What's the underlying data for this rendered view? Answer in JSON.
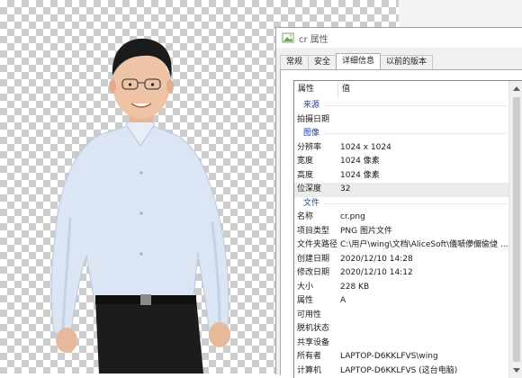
{
  "window": {
    "title": "cr 属性",
    "tabs": [
      {
        "label": "常规"
      },
      {
        "label": "安全"
      },
      {
        "label": "详细信息"
      },
      {
        "label": "以前的版本"
      }
    ]
  },
  "columns": {
    "property": "属性",
    "value": "值"
  },
  "rows": [
    {
      "group": "来源"
    },
    {
      "key": "拍摄日期",
      "value": ""
    },
    {
      "group": "图像"
    },
    {
      "key": "分辨率",
      "value": "1024 x 1024"
    },
    {
      "key": "宽度",
      "value": "1024 像素"
    },
    {
      "key": "高度",
      "value": "1024 像素"
    },
    {
      "key": "位深度",
      "value": "32",
      "selected": true
    },
    {
      "group": "文件"
    },
    {
      "key": "名称",
      "value": "cr.png"
    },
    {
      "key": "项目类型",
      "value": "PNG 图片文件"
    },
    {
      "key": "文件夹路径",
      "value": "C:\\用户\\wing\\文档\\AliceSoft\\儀嗁儚儞偸偼 ..."
    },
    {
      "key": "创建日期",
      "value": "2020/12/10 14:28"
    },
    {
      "key": "修改日期",
      "value": "2020/12/10 14:12"
    },
    {
      "key": "大小",
      "value": "228 KB"
    },
    {
      "key": "属性",
      "value": "A"
    },
    {
      "key": "可用性",
      "value": ""
    },
    {
      "key": "脱机状态",
      "value": ""
    },
    {
      "key": "共享设备",
      "value": ""
    },
    {
      "key": "所有者",
      "value": "LAPTOP-D6KKLFVS\\wing"
    },
    {
      "key": "计算机",
      "value": "LAPTOP-D6KKLFVS (这台电脑)"
    }
  ],
  "colors": {
    "accent": "#1e3f9e",
    "selected_row": "#ececec",
    "checker": "#cccccc"
  }
}
